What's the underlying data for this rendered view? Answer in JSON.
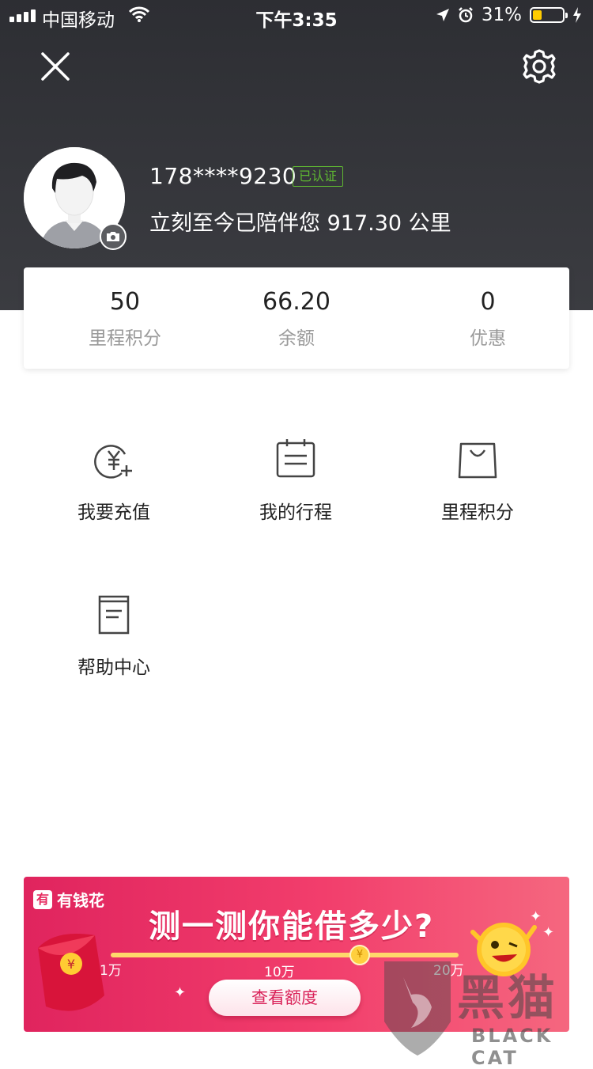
{
  "status_bar": {
    "carrier": "中国移动",
    "time": "下午3:35",
    "battery_percent": "31%",
    "battery_level": 0.31
  },
  "header": {
    "close_icon": "close-icon",
    "settings_icon": "gear-icon"
  },
  "profile": {
    "phone": "178****9230",
    "verified_badge": "已认证",
    "mileage_text": "立刻至今已陪伴您 917.30 公里"
  },
  "stats": [
    {
      "value": "50",
      "label": "里程积分"
    },
    {
      "value": "66.20",
      "label": "余额"
    },
    {
      "value": "0",
      "label": "优惠"
    }
  ],
  "menu": [
    {
      "label": "我要充值",
      "icon": "recharge-icon"
    },
    {
      "label": "我的行程",
      "icon": "calendar-icon"
    },
    {
      "label": "里程积分",
      "icon": "shopping-bag-icon"
    },
    {
      "label": "帮助中心",
      "icon": "document-icon"
    }
  ],
  "banner": {
    "brand_logo": "有",
    "brand": "有钱花",
    "headline": "测一测你能借多少?",
    "ticks": [
      "1万",
      "10万",
      "20万"
    ],
    "knob_symbol": "¥",
    "cta": "查看额度"
  },
  "watermark": {
    "cn": "黑猫",
    "en": "BLACK CAT"
  },
  "colors": {
    "header_bg": "#2d2e33",
    "verified": "#5fb832",
    "banner": "#e62a5f",
    "battery": "#ffcc00"
  }
}
